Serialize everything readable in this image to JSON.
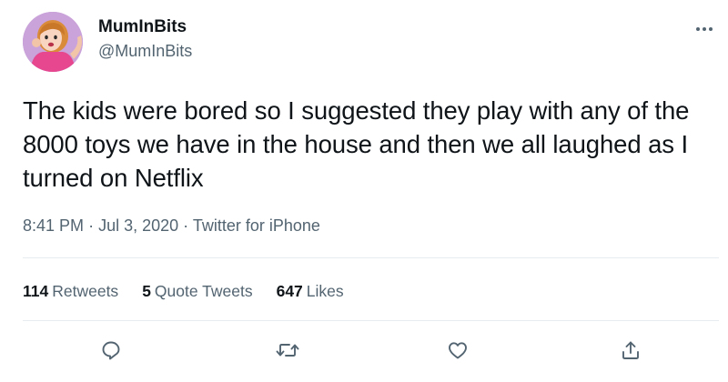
{
  "author": {
    "display_name": "MumInBits",
    "handle": "@MumInBits",
    "avatar_icon": "cartoon-woman-avatar"
  },
  "tweet": {
    "text": "The kids were bored so I suggested they play with any of the 8000 toys we have in the house and then we all laughed as I turned on Netflix",
    "time": "8:41 PM",
    "date": "Jul 3, 2020",
    "source": "Twitter for iPhone",
    "separator": "·"
  },
  "stats": {
    "retweets_count": "114",
    "retweets_label": "Retweets",
    "quotes_count": "5",
    "quotes_label": "Quote Tweets",
    "likes_count": "647",
    "likes_label": "Likes"
  },
  "actions": {
    "reply_icon": "reply-icon",
    "retweet_icon": "retweet-icon",
    "like_icon": "heart-icon",
    "share_icon": "share-icon",
    "more_icon": "more-icon"
  },
  "colors": {
    "text_primary": "#0f1419",
    "text_secondary": "#536471",
    "divider": "#e6ecf0",
    "icon": "#536471"
  }
}
